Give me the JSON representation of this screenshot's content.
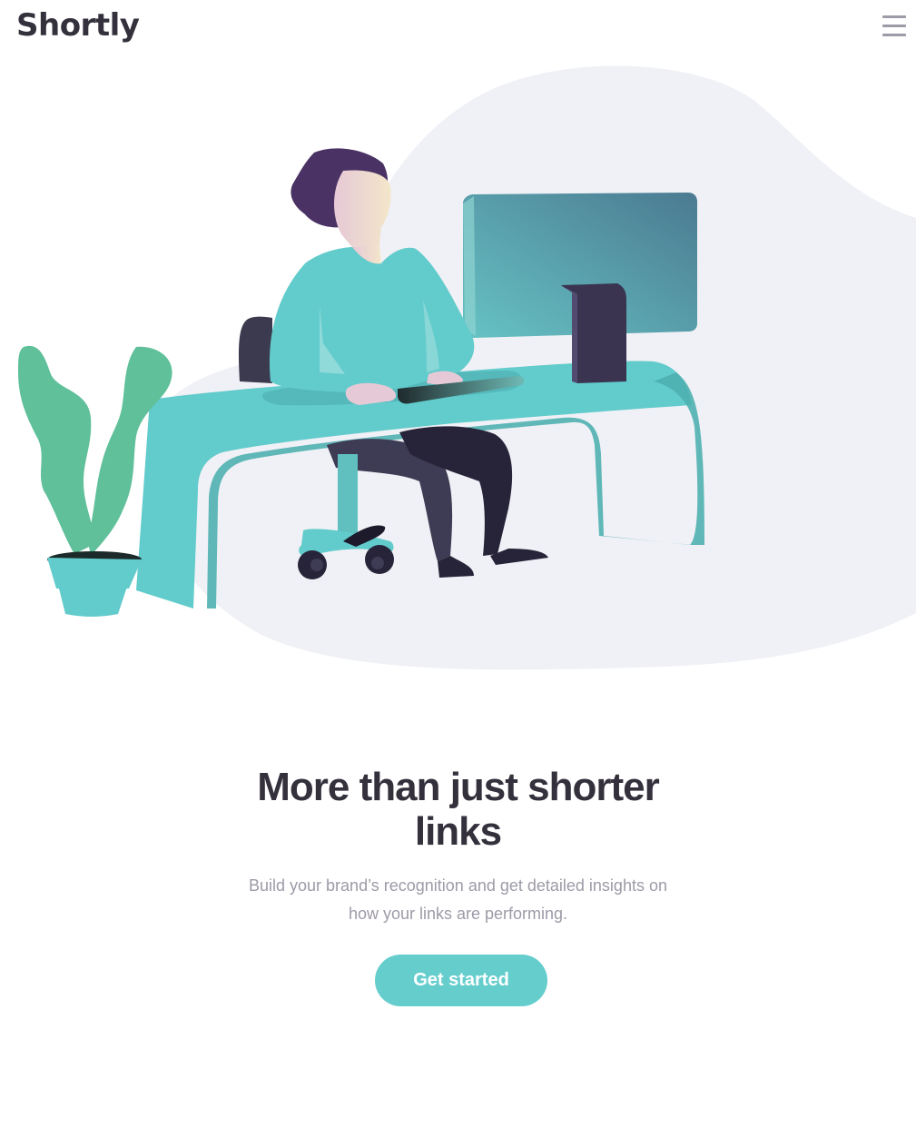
{
  "header": {
    "logo": "Shortly"
  },
  "hero": {
    "headline": "More than just shorter links",
    "subtext": "Build your brand’s recognition and get detailed insights on how your links are performing.",
    "cta_label": "Get started"
  },
  "colors": {
    "accent": "#66cdcd",
    "dark_text": "#34313d",
    "muted_text": "#9e9aa7",
    "blob": "#f0f1f6",
    "plant": "#5fc09a",
    "hair": "#4a3264"
  },
  "icons": {
    "menu": "hamburger-menu-icon"
  }
}
